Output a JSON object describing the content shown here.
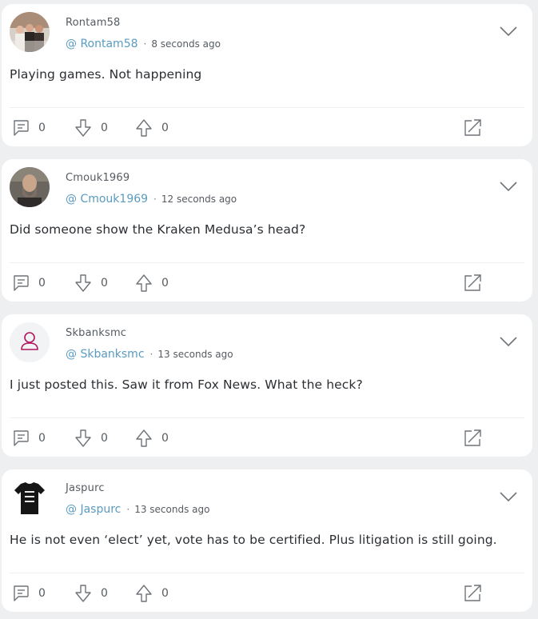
{
  "posts": [
    {
      "username": "Rontam58",
      "handle": "@ Rontam58",
      "time": "8 seconds ago",
      "text": "Playing games. Not happening",
      "replies": "0",
      "downvotes": "0",
      "upvotes": "0",
      "avatar": "photo-group"
    },
    {
      "username": "Cmouk1969",
      "handle": "@ Cmouk1969",
      "time": "12 seconds ago",
      "text": "Did someone show the Kraken Medusa’s head?",
      "replies": "0",
      "downvotes": "0",
      "upvotes": "0",
      "avatar": "photo-bearded-man"
    },
    {
      "username": "Skbanksmc",
      "handle": "@ Skbanksmc",
      "time": "13 seconds ago",
      "text": "I just posted this. Saw it from Fox News. What the heck?",
      "replies": "0",
      "downvotes": "0",
      "upvotes": "0",
      "avatar": "default-user-icon"
    },
    {
      "username": "Jaspurc",
      "handle": "@ Jaspurc",
      "time": "13 seconds ago",
      "text": "He is not even ‘elect’ yet, vote has to be certified. Plus litigation is still going.",
      "replies": "0",
      "downvotes": "0",
      "upvotes": "0",
      "avatar": "photo-tshirt"
    }
  ],
  "colors": {
    "background": "#eeeff1",
    "card": "#ffffff",
    "handle": "#5a9bc0",
    "icon": "#6f7478",
    "default_avatar": "#b0155e"
  }
}
